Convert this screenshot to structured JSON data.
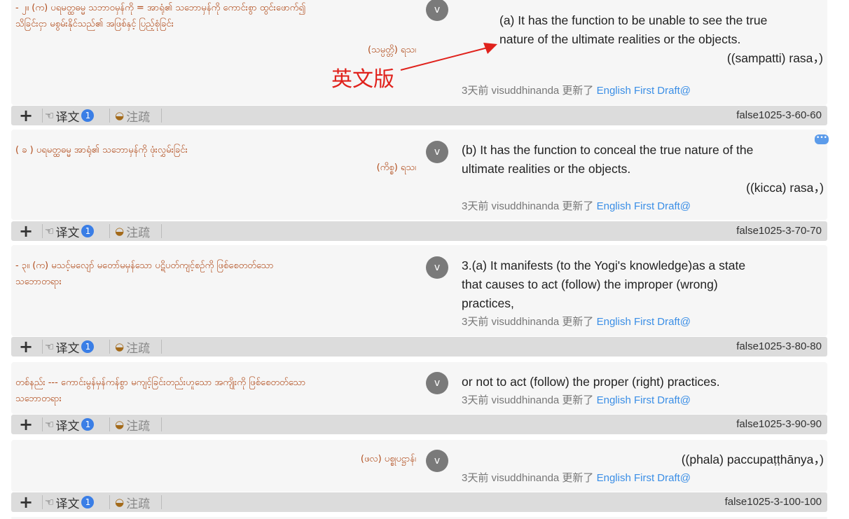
{
  "annotation": {
    "label": "英文版",
    "color": "#e0221c"
  },
  "rows": [
    {
      "pali_lines": [
        "- ၂။ (က) ပရမတ္ထဓမ္မ သဘာဝမှန်ကို = အာရုံ၏ သဘောမှန်ကို ကောင်းစွာ ထွင်းဖောက်၍",
        "သိခြင်းငှာ မစွမ်းနိုင်သည်၏ အဖြစ်နှင့် ပြည့်စုံခြင်း"
      ],
      "pali_right": "(သမ္ပတ္တိ) ရသ၊",
      "avatar": "v",
      "trans_lines": [
        "(a) It has the function to be unable to see the true",
        "nature of the ultimate realities or the objects."
      ],
      "trans_right": "((sampatti) rasa，)",
      "meta_prefix": "3天前 visuddhinanda 更新了 ",
      "meta_link": "English First Draft@",
      "toolbar": {
        "plus": "+",
        "trans_label": "译文",
        "trans_count": "1",
        "note_label": "注疏",
        "id": "false1025-3-60-60"
      }
    },
    {
      "pali_lines": [
        "( ခ ) ပရမတ္ထဓမ္မ အာရုံ၏ သဘောမှန်ကို ဖုံးလွှမ်းခြင်း"
      ],
      "pali_right": "(ကိစ္စ) ရသ၊",
      "avatar": "v",
      "trans_lines": [
        "(b) It has the function to conceal the true nature of the",
        "ultimate realities or the objects."
      ],
      "trans_right": "((kicca) rasa，)",
      "meta_prefix": "3天前 visuddhinanda 更新了 ",
      "meta_link": "English First Draft@",
      "toolbar": {
        "plus": "+",
        "trans_label": "译文",
        "trans_count": "1",
        "note_label": "注疏",
        "id": "false1025-3-70-70"
      }
    },
    {
      "pali_lines": [
        "- ၃။ (က) မသင့်မလျော် မတော်မမှန်သော ပဋိပတ်ကျင့်စဉ်ကို ဖြစ်စေတတ်သော",
        "သဘောတရား"
      ],
      "pali_right": "",
      "avatar": "v",
      "trans_lines": [
        "3.(a) It manifests (to the Yogi's knowledge)as a state",
        "that causes to act (follow) the improper (wrong)",
        "practices,"
      ],
      "trans_right": "",
      "meta_prefix": "3天前 visuddhinanda 更新了 ",
      "meta_link": "English First Draft@",
      "toolbar": {
        "plus": "+",
        "trans_label": "译文",
        "trans_count": "1",
        "note_label": "注疏",
        "id": "false1025-3-80-80"
      }
    },
    {
      "pali_lines": [
        "တစ်နည်း --- ကောင်းမွန်မှန်ကန်စွာ မကျင့်ခြင်းတည်းဟူသော အကျိုးကို ဖြစ်စေတတ်သော",
        "သဘောတရား"
      ],
      "pali_right": "",
      "avatar": "v",
      "trans_lines": [
        "or not to act (follow) the proper (right) practices."
      ],
      "trans_right": "",
      "meta_prefix": "3天前 visuddhinanda 更新了 ",
      "meta_link": "English First Draft@",
      "toolbar": {
        "plus": "+",
        "trans_label": "译文",
        "trans_count": "1",
        "note_label": "注疏",
        "id": "false1025-3-90-90"
      }
    },
    {
      "pali_lines": [],
      "pali_right": "(ဖလ) ပစ္စုပဋ္ဌာန်၊",
      "avatar": "v",
      "trans_lines": [],
      "trans_right": "((phala) paccupaṭṭhānya，)",
      "meta_prefix": "3天前 visuddhinanda 更新了 ",
      "meta_link": "English First Draft@",
      "toolbar": {
        "plus": "+",
        "trans_label": "译文",
        "trans_count": "1",
        "note_label": "注疏",
        "id": "false1025-3-100-100"
      }
    }
  ]
}
